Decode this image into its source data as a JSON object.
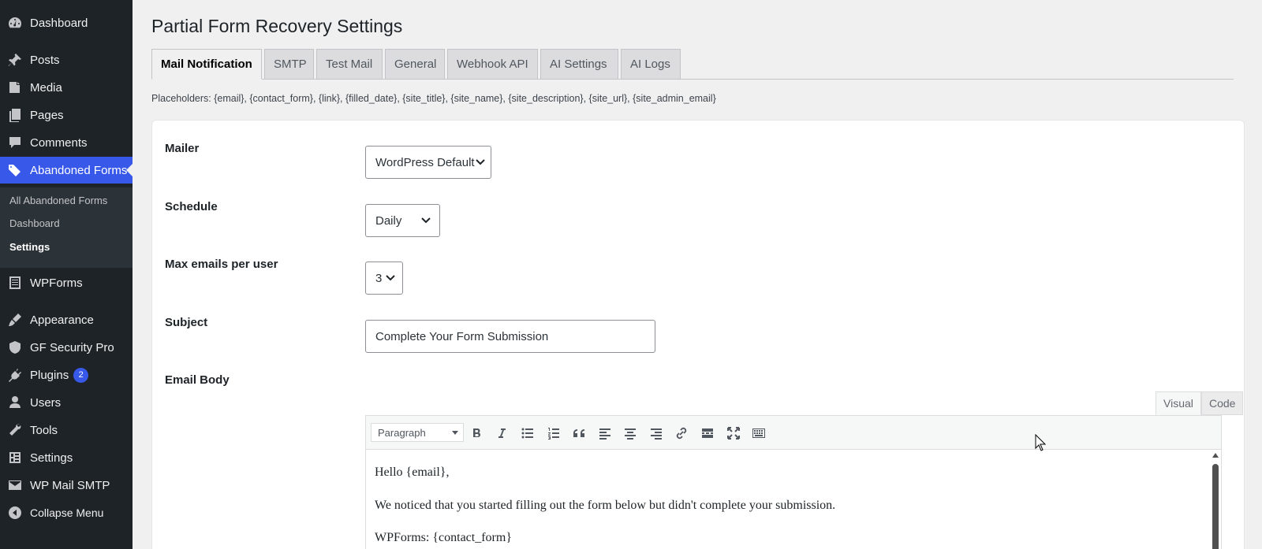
{
  "sidebar": {
    "items": [
      {
        "label": "Dashboard",
        "icon": "dashboard-icon"
      },
      {
        "label": "Posts",
        "icon": "pushpin-icon"
      },
      {
        "label": "Media",
        "icon": "media-icon"
      },
      {
        "label": "Pages",
        "icon": "pages-icon"
      },
      {
        "label": "Comments",
        "icon": "comment-icon"
      },
      {
        "label": "Abandoned Forms",
        "icon": "tag-icon"
      },
      {
        "label": "WPForms",
        "icon": "form-icon"
      },
      {
        "label": "Appearance",
        "icon": "brush-icon"
      },
      {
        "label": "GF Security Pro",
        "icon": "shield-icon"
      },
      {
        "label": "Plugins",
        "icon": "plugin-icon",
        "badge": "2"
      },
      {
        "label": "Users",
        "icon": "user-icon"
      },
      {
        "label": "Tools",
        "icon": "wrench-icon"
      },
      {
        "label": "Settings",
        "icon": "settings-icon"
      },
      {
        "label": "WP Mail SMTP",
        "icon": "mail-icon"
      },
      {
        "label": "Collapse Menu",
        "icon": "collapse-icon"
      }
    ],
    "submenu": [
      "All Abandoned Forms",
      "Dashboard",
      "Settings"
    ]
  },
  "page": {
    "title": "Partial Form Recovery Settings",
    "tabs": [
      "Mail Notification",
      "SMTP",
      "Test Mail",
      "General",
      "Webhook API",
      "AI Settings",
      "AI Logs"
    ],
    "active_tab": "Mail Notification",
    "placeholders": "Placeholders: {email}, {contact_form}, {link}, {filled_date}, {site_title}, {site_name}, {site_description}, {site_url}, {site_admin_email}"
  },
  "form": {
    "mailer": {
      "label": "Mailer",
      "value": "WordPress Default"
    },
    "schedule": {
      "label": "Schedule",
      "value": "Daily"
    },
    "max_emails": {
      "label": "Max emails per user",
      "value": "3"
    },
    "subject": {
      "label": "Subject",
      "value": "Complete Your Form Submission"
    },
    "email_body": {
      "label": "Email Body"
    }
  },
  "editor": {
    "tab_visual": "Visual",
    "tab_code": "Code",
    "format": "Paragraph",
    "toolbar_icons": [
      "bold-icon",
      "italic-icon",
      "bullet-list-icon",
      "numbered-list-icon",
      "blockquote-icon",
      "align-left-icon",
      "align-center-icon",
      "align-right-icon",
      "link-icon",
      "read-more-icon",
      "fullscreen-icon",
      "toolbar-toggle-icon"
    ],
    "content": [
      "Hello {email},",
      "We noticed that you started filling out the form below but didn't complete your submission.",
      "WPForms: {contact_form}"
    ]
  },
  "colors": {
    "sidebar_bg": "#1d2327",
    "active_menu": "#3858e9",
    "submenu_bg": "#2c3338",
    "page_bg": "#f0f0f1"
  }
}
